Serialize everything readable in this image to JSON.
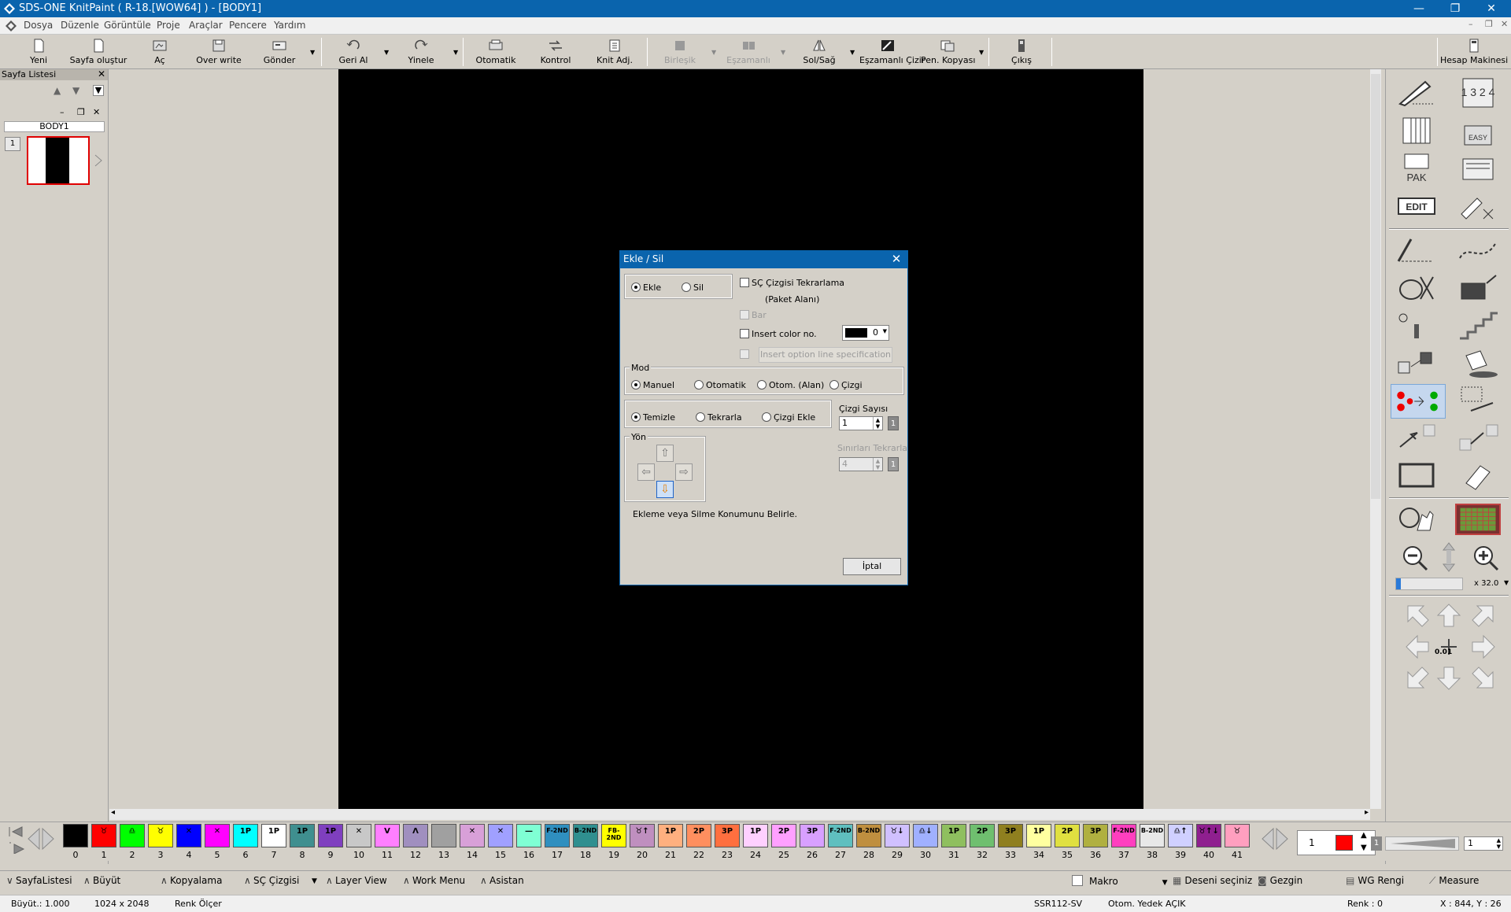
{
  "titlebar": {
    "title": "SDS-ONE KnitPaint ( R-18.[WOW64] ) - [BODY1]",
    "minimize": "—",
    "restore": "❐",
    "close": "✕"
  },
  "menu": {
    "items": [
      "Dosya",
      "Düzenle",
      "Görüntüle",
      "Proje",
      "Araçlar",
      "Pencere",
      "Yardım"
    ],
    "mdi_min": "–",
    "mdi_restore": "❐",
    "mdi_close": "✕"
  },
  "toolbar": {
    "yeni": "Yeni",
    "sayfa_olustur": "Sayfa oluştur",
    "ac": "Aç",
    "over_write": "Over write",
    "gonder": "Gönder",
    "geri_al": "Geri Al",
    "yinele": "Yinele",
    "otomatik": "Otomatik",
    "kontrol": "Kontrol",
    "knit_adj": "Knit Adj.",
    "birlesik": "Birleşik",
    "eszamanli": "Eşzamanlı",
    "sol_sag": "Sol/Sağ",
    "eszamanli_cizir": "Eşzamanlı Çizir",
    "pen_kopyasi": "Pen. Kopyası",
    "cikis": "Çıkış",
    "hesap_makinesi": "Hesap Makinesi"
  },
  "sayfa_listesi": {
    "title": "Sayfa Listesi",
    "close": "✕",
    "up": "▲",
    "down": "▼",
    "menu": "▼",
    "sheet_min": "–",
    "sheet_restore": "❐",
    "sheet_close": "✕",
    "body_label": "BODY1",
    "thumb_number": "1"
  },
  "right_panel": {
    "edit_label": "EDIT",
    "pak_label": "PAK",
    "easy_label": "EASY",
    "zoom_value": "x 32.0",
    "step_label": "0.01",
    "numbers_icon": "1 3 2 4"
  },
  "palette": {
    "swatches": [
      {
        "n": "0",
        "c": "#000000",
        "t": ""
      },
      {
        "n": "1",
        "c": "#ff0000",
        "t": "♉"
      },
      {
        "n": "2",
        "c": "#00ff00",
        "t": "♎"
      },
      {
        "n": "3",
        "c": "#ffff00",
        "t": "♉"
      },
      {
        "n": "4",
        "c": "#0000ff",
        "t": "✕"
      },
      {
        "n": "5",
        "c": "#ff00ff",
        "t": "✕"
      },
      {
        "n": "6",
        "c": "#00ffff",
        "t": "1P"
      },
      {
        "n": "7",
        "c": "#ffffff",
        "t": "1P"
      },
      {
        "n": "8",
        "c": "#3f8f8f",
        "t": "1P"
      },
      {
        "n": "9",
        "c": "#7f3fbf",
        "t": "1P"
      },
      {
        "n": "10",
        "c": "#c8c8c8",
        "t": "✕"
      },
      {
        "n": "11",
        "c": "#ff7fff",
        "t": "V"
      },
      {
        "n": "12",
        "c": "#a08fbf",
        "t": "Λ"
      },
      {
        "n": "13",
        "c": "#a0a0a0",
        "t": ""
      },
      {
        "n": "14",
        "c": "#d8a0d8",
        "t": "✕"
      },
      {
        "n": "15",
        "c": "#a0a0ff",
        "t": "✕"
      },
      {
        "n": "16",
        "c": "#7fffd4",
        "t": "—"
      },
      {
        "n": "17",
        "c": "#2f8fbf",
        "t": "F-2ND"
      },
      {
        "n": "18",
        "c": "#2f8f8f",
        "t": "B-2ND"
      },
      {
        "n": "19",
        "c": "#ffff00",
        "t": "FB-2ND"
      },
      {
        "n": "20",
        "c": "#bf8fbf",
        "t": "♉↑"
      },
      {
        "n": "21",
        "c": "#ffb07f",
        "t": "1P"
      },
      {
        "n": "22",
        "c": "#ff8f5f",
        "t": "2P"
      },
      {
        "n": "23",
        "c": "#ff6f3f",
        "t": "3P"
      },
      {
        "n": "24",
        "c": "#ffd0ff",
        "t": "1P"
      },
      {
        "n": "25",
        "c": "#ffa0ff",
        "t": "2P"
      },
      {
        "n": "26",
        "c": "#d8a0ff",
        "t": "3P"
      },
      {
        "n": "27",
        "c": "#5fbfbf",
        "t": "F-2ND"
      },
      {
        "n": "28",
        "c": "#bf8f3f",
        "t": "B-2ND"
      },
      {
        "n": "29",
        "c": "#d0c0ff",
        "t": "♉↓"
      },
      {
        "n": "30",
        "c": "#a0b0ff",
        "t": "♎↓"
      },
      {
        "n": "31",
        "c": "#8fbf5f",
        "t": "1P"
      },
      {
        "n": "32",
        "c": "#6fbf6f",
        "t": "2P"
      },
      {
        "n": "33",
        "c": "#8f7f1f",
        "t": "3P"
      },
      {
        "n": "34",
        "c": "#ffffa0",
        "t": "1P"
      },
      {
        "n": "35",
        "c": "#e0e040",
        "t": "2P"
      },
      {
        "n": "36",
        "c": "#b0b040",
        "t": "3P"
      },
      {
        "n": "37",
        "c": "#ff3fbf",
        "t": "F-2ND"
      },
      {
        "n": "38",
        "c": "#e8e8e8",
        "t": "B-2ND"
      },
      {
        "n": "39",
        "c": "#d0d0ff",
        "t": "♎↑"
      },
      {
        "n": "40",
        "c": "#8f1f8f",
        "t": "♉↑↓"
      },
      {
        "n": "41",
        "c": "#ff9fbf",
        "t": "♉"
      }
    ],
    "page_value": "1",
    "speed_value": "1"
  },
  "tabs": {
    "sayfa_listesi": "SayfaListesi",
    "buyut": "Büyüt",
    "kopyalama": "Kopyalama",
    "sc_cizgisi": "SÇ Çizgisi",
    "layer_view": "Layer View",
    "work_menu": "Work Menu",
    "asistan": "Asistan",
    "makro": "Makro",
    "deseni_seciniz": "Deseni seçiniz",
    "gezgin": "Gezgin",
    "wg_rengi": "WG Rengi",
    "measure": "Measure"
  },
  "status": {
    "buyut": "Büyüt.:  1.000",
    "size": "1024 x 2048",
    "renk_olcer": "Renk Ölçer",
    "machine": "SSR112-SV",
    "otom": "Otom. Yedek AÇIK",
    "renk": "Renk :  0",
    "coords": "X : 844, Y :  26"
  },
  "dialog": {
    "title": "Ekle / Sil",
    "close": "✕",
    "ekle": "Ekle",
    "sil": "Sil",
    "sc_tekrar": "SÇ Çizgisi Tekrarlama",
    "paket_alani": "(Paket Alanı)",
    "bar": "Bar",
    "insert_color": "Insert color no.",
    "color_value": "0",
    "insert_option": "Insert option line specification",
    "mod_label": "Mod",
    "manuel": "Manuel",
    "otomatik": "Otomatik",
    "otom_alan": "Otom. (Alan)",
    "cizgi": "Çizgi",
    "temizle": "Temizle",
    "tekrarla": "Tekrarla",
    "cizgi_ekle": "Çizgi Ekle",
    "cizgi_sayisi": "Çizgi Sayısı",
    "cizgi_sayisi_value": "1",
    "sinirlari_tekrarla": "Sınırları Tekrarla",
    "sinir_value": "4",
    "yon": "Yön",
    "hint": "Ekleme veya Silme Konumunu Belirle.",
    "iptal": "İptal"
  },
  "colors": {
    "titlebar": "#0a64ad",
    "canvas": "#000000",
    "current_color": "#ff0000",
    "selection_border": "#e00000"
  }
}
